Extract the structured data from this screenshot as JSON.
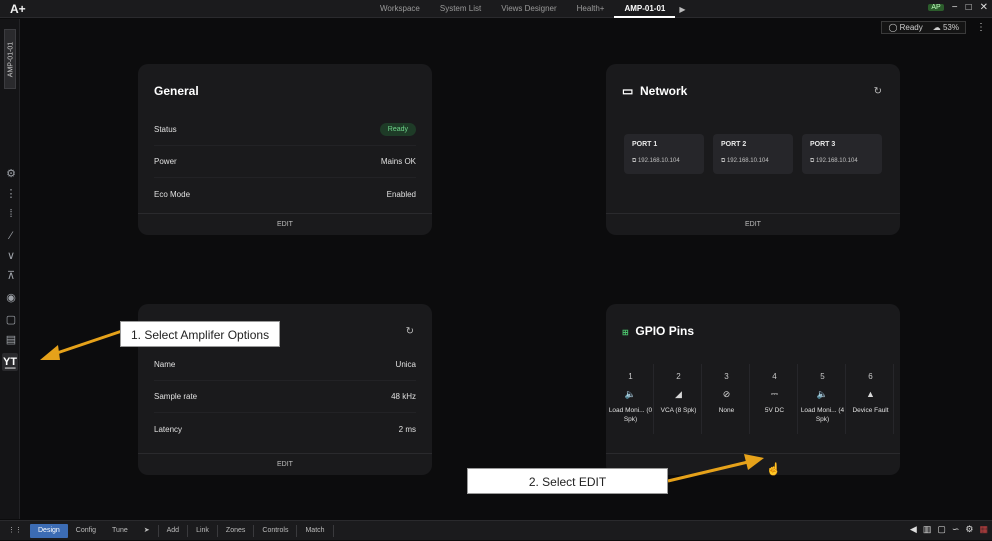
{
  "app": {
    "logo": "A+"
  },
  "tabs": [
    "Workspace",
    "System List",
    "Views Designer",
    "Health+",
    "AMP-01-01"
  ],
  "active_tab_arrow": "▶",
  "window_controls": [
    "AP",
    "−",
    "□",
    "✕"
  ],
  "status": {
    "ready": "Ready",
    "cpu": "53%"
  },
  "sidebar": {
    "vertical_tab": "AMP-01-01",
    "tools": [
      "gear-icon",
      "flow-icon",
      "grid-icon",
      "curve-icon",
      "notch-icon",
      "filter-icon",
      "speaker-icon",
      "lock-icon",
      "save-icon",
      "amp-options-icon"
    ]
  },
  "general": {
    "title": "General",
    "rows": [
      {
        "label": "Status",
        "value": "Ready"
      },
      {
        "label": "Power",
        "value": "Mains OK"
      },
      {
        "label": "Eco Mode",
        "value": "Enabled"
      }
    ],
    "footer": "EDIT"
  },
  "network": {
    "title": "Network",
    "ports": [
      {
        "name": "PORT 1",
        "ip": "192.168.10.104"
      },
      {
        "name": "PORT 2",
        "ip": "192.168.10.104"
      },
      {
        "name": "PORT 3",
        "ip": "192.168.10.104"
      }
    ],
    "footer": "EDIT"
  },
  "audio": {
    "rows": [
      {
        "label": "Name",
        "value": "Unica"
      },
      {
        "label": "Sample rate",
        "value": "48 kHz"
      },
      {
        "label": "Latency",
        "value": "2 ms"
      }
    ],
    "footer": "EDIT"
  },
  "gpio": {
    "title": "GPIO Pins",
    "pins": [
      {
        "num": "1",
        "icon": "🔈",
        "label": "Load Moni... (0 Spk)"
      },
      {
        "num": "2",
        "icon": "◢",
        "label": "VCA (8 Spk)"
      },
      {
        "num": "3",
        "icon": "⊘",
        "label": "None"
      },
      {
        "num": "4",
        "icon": "⎓",
        "label": "5V DC"
      },
      {
        "num": "5",
        "icon": "🔈",
        "label": "Load Moni... (4 Spk)"
      },
      {
        "num": "6",
        "icon": "▲",
        "label": "Device Fault"
      }
    ]
  },
  "callouts": {
    "one": "1. Select Amplifer Options",
    "two": "2. Select EDIT"
  },
  "bottombar": {
    "modes": [
      "Design",
      "Config",
      "Tune"
    ],
    "actions": [
      "Add",
      "Link",
      "Zones",
      "Controls",
      "Match"
    ]
  }
}
